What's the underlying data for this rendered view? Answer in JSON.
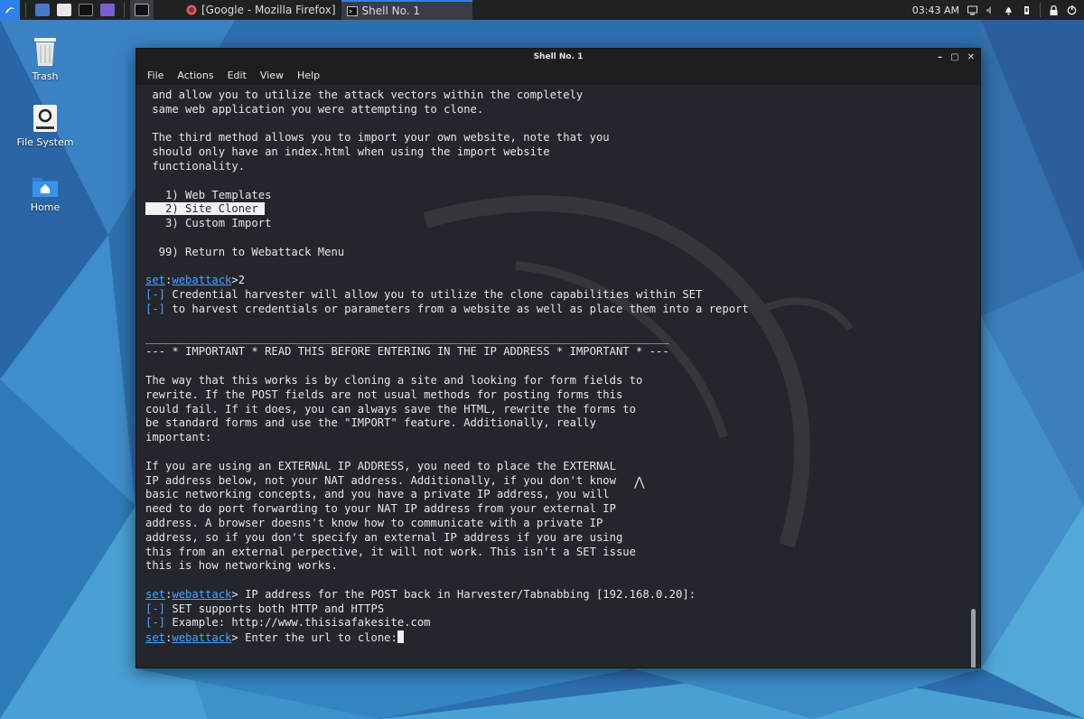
{
  "colors": {
    "panel": "#1f2124",
    "terminal_bg": "#23262c",
    "accent_blue": "#4aa3ff",
    "text": "#e6e6e6"
  },
  "panel": {
    "launchers": [
      "kali-menu-icon",
      "desktop-icon",
      "files-icon",
      "terminal-icon",
      "screenshot-icon",
      "terminal-task-icon"
    ],
    "tasks": [
      {
        "label": "[Google - Mozilla Firefox]",
        "icon": "firefox-icon"
      },
      {
        "label": "Shell No. 1",
        "icon": "terminal-icon"
      }
    ],
    "clock": "03:43 AM",
    "tray_icons": [
      "display-icon",
      "volume-icon",
      "notification-bell-icon",
      "power-plug-icon",
      "lock-icon",
      "logout-icon"
    ]
  },
  "desktop": {
    "icons": [
      {
        "label": "Trash",
        "icon": "trash-icon"
      },
      {
        "label": "File System",
        "icon": "drive-icon"
      },
      {
        "label": "Home",
        "icon": "home-folder-icon"
      }
    ]
  },
  "window": {
    "title": "Shell No. 1",
    "controls": [
      "minimize",
      "maximize",
      "close"
    ],
    "menu": [
      "File",
      "Actions",
      "Edit",
      "View",
      "Help"
    ]
  },
  "terminal": {
    "prompt_set": "set",
    "prompt_module": "webattack",
    "bullet": "[-]",
    "lines": [
      " and allow you to utilize the attack vectors within the completely",
      " same web application you were attempting to clone.",
      "",
      " The third method allows you to import your own website, note that you",
      " should only have an index.html when using the import website",
      " functionality.",
      "",
      "   1) Web Templates",
      "   2) Site Cloner",
      "   3) Custom Import",
      "",
      "  99) Return to Webattack Menu",
      "",
      "__PROMPT__>2",
      "__BULLET__ Credential harvester will allow you to utilize the clone capabilities within SET",
      "__BULLET__ to harvest credentials or parameters from a website as well as place them into a report",
      "",
      "_______________________________________________________________________________",
      "--- * IMPORTANT * READ THIS BEFORE ENTERING IN THE IP ADDRESS * IMPORTANT * ---",
      "",
      "The way that this works is by cloning a site and looking for form fields to",
      "rewrite. If the POST fields are not usual methods for posting forms this",
      "could fail. If it does, you can always save the HTML, rewrite the forms to",
      "be standard forms and use the \"IMPORT\" feature. Additionally, really",
      "important:",
      "",
      "If you are using an EXTERNAL IP ADDRESS, you need to place the EXTERNAL",
      "IP address below, not your NAT address. Additionally, if you don't know",
      "basic networking concepts, and you have a private IP address, you will",
      "need to do port forwarding to your NAT IP address from your external IP",
      "address. A browser doesns't know how to communicate with a private IP",
      "address, so if you don't specify an external IP address if you are using",
      "this from an external perpective, it will not work. This isn't a SET issue",
      "this is how networking works.",
      "",
      "__PROMPT__> IP address for the POST back in Harvester/Tabnabbing [192.168.0.20]:",
      "__BULLET__ SET supports both HTTP and HTTPS",
      "__BULLET__ Example: http://www.thisisafakesite.com",
      "__PROMPT__> Enter the url to clone:__CURSOR__"
    ],
    "highlighted_line_index": 8
  }
}
